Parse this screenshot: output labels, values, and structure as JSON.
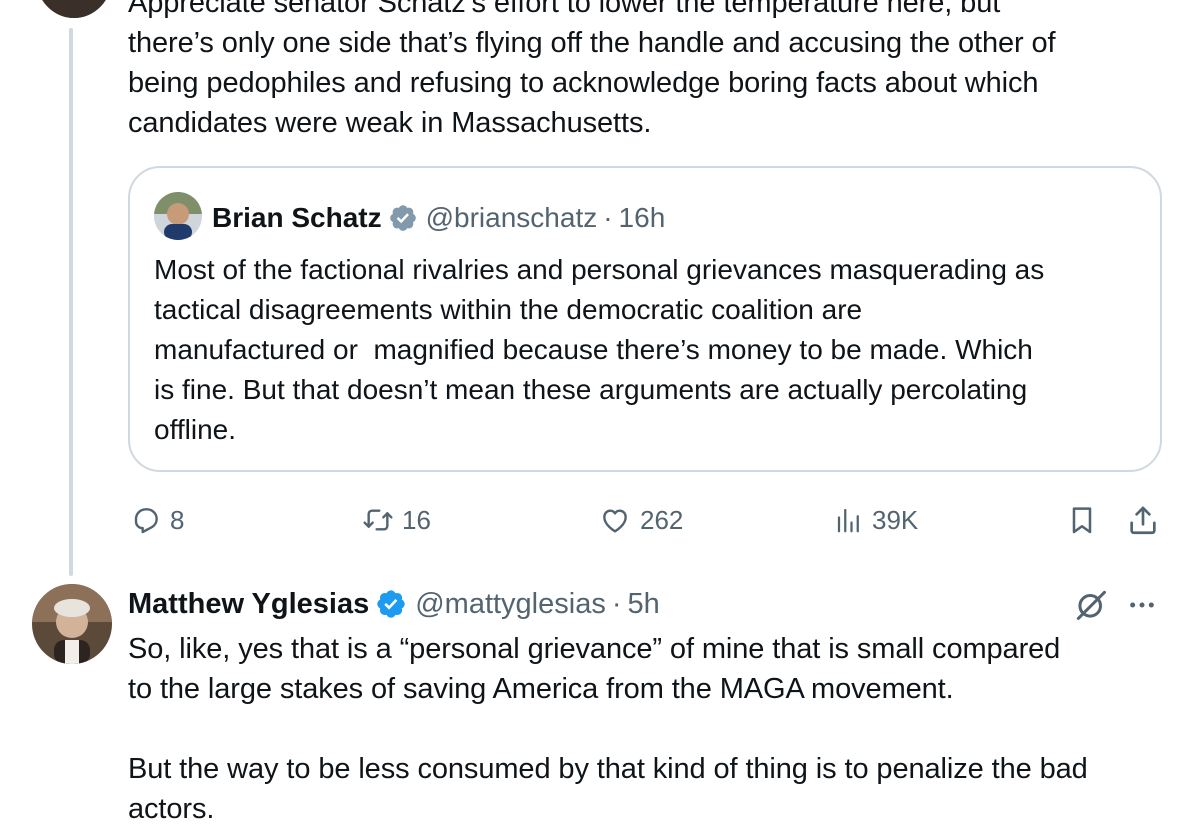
{
  "tweet1": {
    "text": "Appreciate senator Schatz’s effort to lower the temperature here, but\nthere’s only one side that’s flying off the handle and accusing the other of\nbeing pedophiles and refusing to acknowledge boring facts about which\ncandidates were weak in Massachusetts.",
    "quote": {
      "name": "Brian Schatz",
      "handle": "@brianschatz",
      "time": "16h",
      "text": "Most of the factional rivalries and personal grievances masquerading as\ntactical disagreements within the democratic coalition are\nmanufactured or  magnified because there’s money to be made. Which\nis fine. But that doesn’t mean these arguments are actually percolating\noffline.",
      "verified_color": "#829aab"
    },
    "actions": {
      "replies": "8",
      "reposts": "16",
      "likes": "262",
      "views": "39K"
    }
  },
  "tweet2": {
    "name": "Matthew Yglesias",
    "handle": "@mattyglesias",
    "time": "5h",
    "text": "So, like, yes that is a “personal grievance” of mine that is small compared\nto the large stakes of saving America from the MAGA movement.\n\nBut the way to be less consumed by that kind of thing is to penalize the bad\nactors.",
    "verified_color": "#1d9bf0"
  },
  "separator": "·",
  "icons": [
    "reply-icon",
    "repost-icon",
    "like-icon",
    "views-icon",
    "bookmark-icon",
    "share-icon",
    "grok-icon",
    "more-icon",
    "verified-badge-icon"
  ]
}
